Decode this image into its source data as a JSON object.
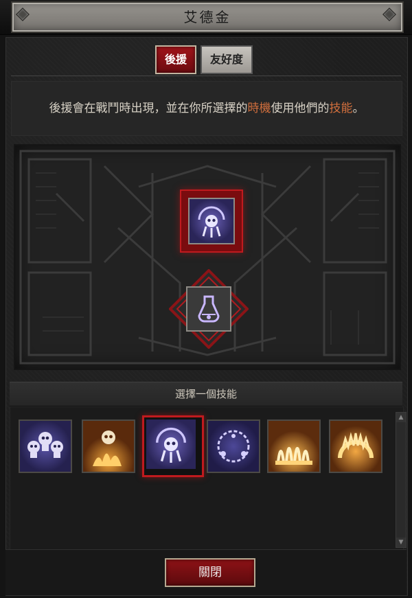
{
  "window": {
    "title": "艾德金"
  },
  "tabs": [
    {
      "label": "後援",
      "active": true
    },
    {
      "label": "友好度",
      "active": false
    }
  ],
  "description": {
    "part1": "後援會在戰鬥時出現，並在你所選擇的",
    "highlight1": "時機",
    "part2": "使用他們的",
    "highlight2": "技能",
    "part3": "。",
    "highlight_color": "#d26f3d"
  },
  "slots": {
    "active_skill_icon": "skull-crest-icon",
    "passive_skill_icon": "potion-icon"
  },
  "skill_chooser": {
    "header": "選擇一個技能",
    "skills": [
      {
        "icon": "three-skulls-icon",
        "theme": "purple"
      },
      {
        "icon": "skull-fire-icon",
        "theme": "orange"
      },
      {
        "icon": "skull-crest-icon",
        "theme": "purple",
        "selected": true
      },
      {
        "icon": "chain-ring-icon",
        "theme": "purple"
      },
      {
        "icon": "fire-claws-icon",
        "theme": "orange"
      },
      {
        "icon": "flame-arc-icon",
        "theme": "orange"
      }
    ]
  },
  "close_button": {
    "label": "關閉"
  },
  "colors": {
    "accent_red": "#c01a1e",
    "purple_skill": "#3c3570",
    "orange_skill": "#b6621a"
  }
}
